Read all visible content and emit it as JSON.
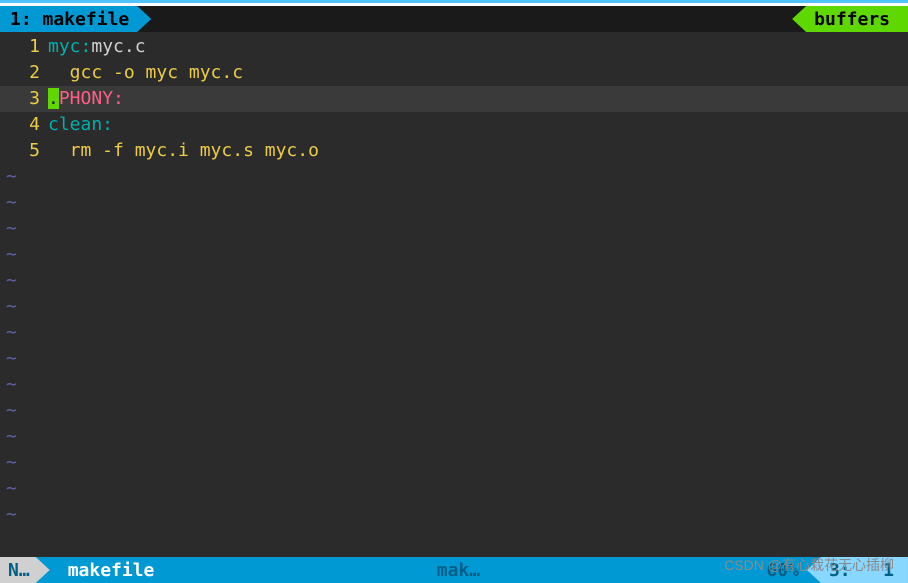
{
  "tab": {
    "label": "1: makefile",
    "right_label": "buffers"
  },
  "lines": [
    {
      "num": "1",
      "current": false,
      "segments": [
        {
          "cls": "target",
          "text": "myc:"
        },
        {
          "cls": "file",
          "text": "myc.c"
        }
      ]
    },
    {
      "num": "2",
      "current": false,
      "segments": [
        {
          "cls": "cmd",
          "text": "  gcc -o myc myc.c"
        }
      ]
    },
    {
      "num": "3",
      "current": true,
      "segments": [
        {
          "cls": "cursor-block",
          "text": "."
        },
        {
          "cls": "phony",
          "text": "PHONY:"
        }
      ]
    },
    {
      "num": "4",
      "current": false,
      "segments": [
        {
          "cls": "target",
          "text": "clean:"
        }
      ]
    },
    {
      "num": "5",
      "current": false,
      "segments": [
        {
          "cls": "cmd",
          "text": "  rm -f myc.i myc.s myc.o"
        }
      ]
    }
  ],
  "tilde": "~",
  "tilde_count": 14,
  "status": {
    "mode": "N…",
    "filename": "makefile",
    "filetype": "mak…",
    "percent": "60%",
    "position": "3:   1"
  },
  "watermark": "CSDN @有心栽花无心插柳"
}
